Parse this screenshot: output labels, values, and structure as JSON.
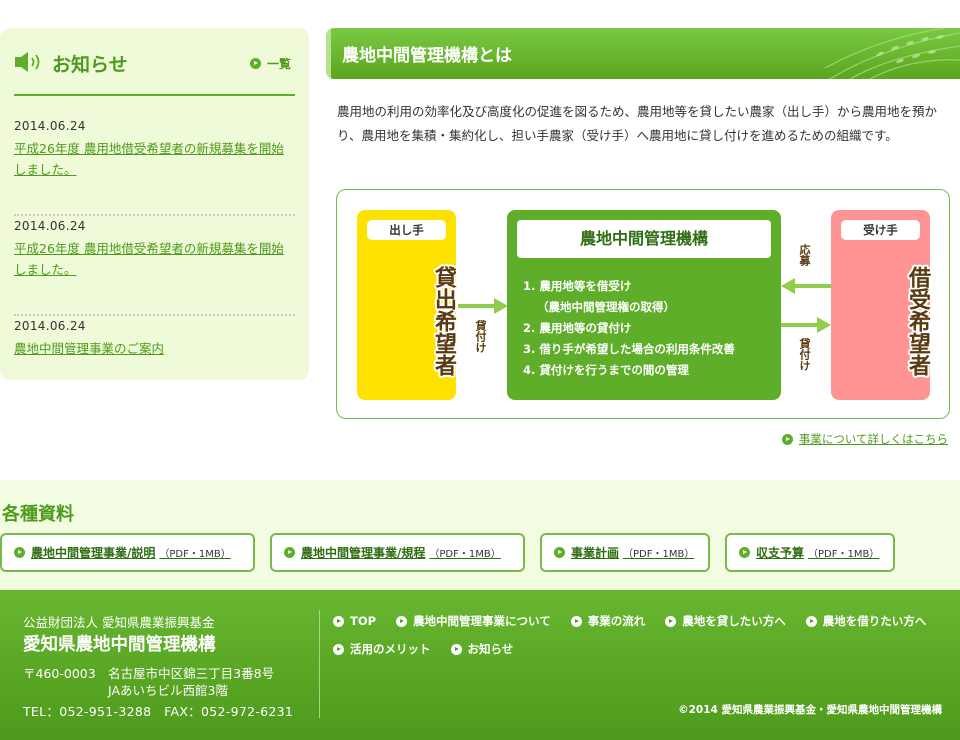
{
  "news": {
    "title": "お知らせ",
    "all_link": "一覧",
    "items": [
      {
        "date": "2014.06.24",
        "text": "平成26年度 農用地借受希望者の新規募集を開始しました。"
      },
      {
        "date": "2014.06.24",
        "text": "平成26年度 農用地借受希望者の新規募集を開始しました。"
      },
      {
        "date": "2014.06.24",
        "text": "農地中間管理事業のご案内"
      }
    ]
  },
  "section": {
    "title": "農地中間管理機構とは",
    "intro": "農用地の利用の効率化及び高度化の促進を図るため、農用地等を貸したい農家（出し手）から農用地を預かり、農用地を集積・集約化し、担い手農家（受け手）へ農用地に貸し付けを進めるための組織です。"
  },
  "diagram": {
    "giver_tag": "出し手",
    "giver_name": "貸出希望者",
    "receiver_tag": "受け手",
    "receiver_name": "借受希望者",
    "org_title": "農地中間管理機構",
    "org_items": [
      "1. 農用地等を借受け",
      "（農地中間管理権の取得）",
      "2. 農用地等の貸付け",
      "3. 借り手が希望した場合の利用条件改善",
      "4. 貸付けを行うまでの間の管理"
    ],
    "arrow_left_label": "貸付け",
    "arrow_apply_label": "応募",
    "arrow_lend_label": "貸付け"
  },
  "detail_link": "事業について詳しくはこちら",
  "materials": {
    "title": "各種資料",
    "buttons": [
      {
        "label": "農地中間管理事業/説明",
        "suffix": "（PDF・1MB）"
      },
      {
        "label": "農地中間管理事業/規程",
        "suffix": "（PDF・1MB）"
      },
      {
        "label": "事業計画",
        "suffix": "（PDF・1MB）"
      },
      {
        "label": "収支予算",
        "suffix": "（PDF・1MB）"
      }
    ]
  },
  "footer": {
    "org_small": "公益財団法人 愛知県農業振興基金",
    "org_big": "愛知県農地中間管理機構",
    "address1": "〒460-0003　名古屋市中区錦三丁目3番8号",
    "address2": "JAあいちビル西館3階",
    "tel": "TEL：052-951-3288　FAX：052-972-6231",
    "nav": [
      "TOP",
      "農地中間管理事業について",
      "事業の流れ",
      "農地を貸したい方へ",
      "農地を借りたい方へ",
      "活用のメリット",
      "お知らせ"
    ],
    "copyright": "©2014 愛知県農業振興基金・愛知県農地中間管理機構"
  },
  "colors": {
    "brand_green": "#5fae2a",
    "giver_yellow": "#ffe100",
    "receiver_pink": "#ff9495",
    "sidebar_bg": "#eefad8"
  }
}
